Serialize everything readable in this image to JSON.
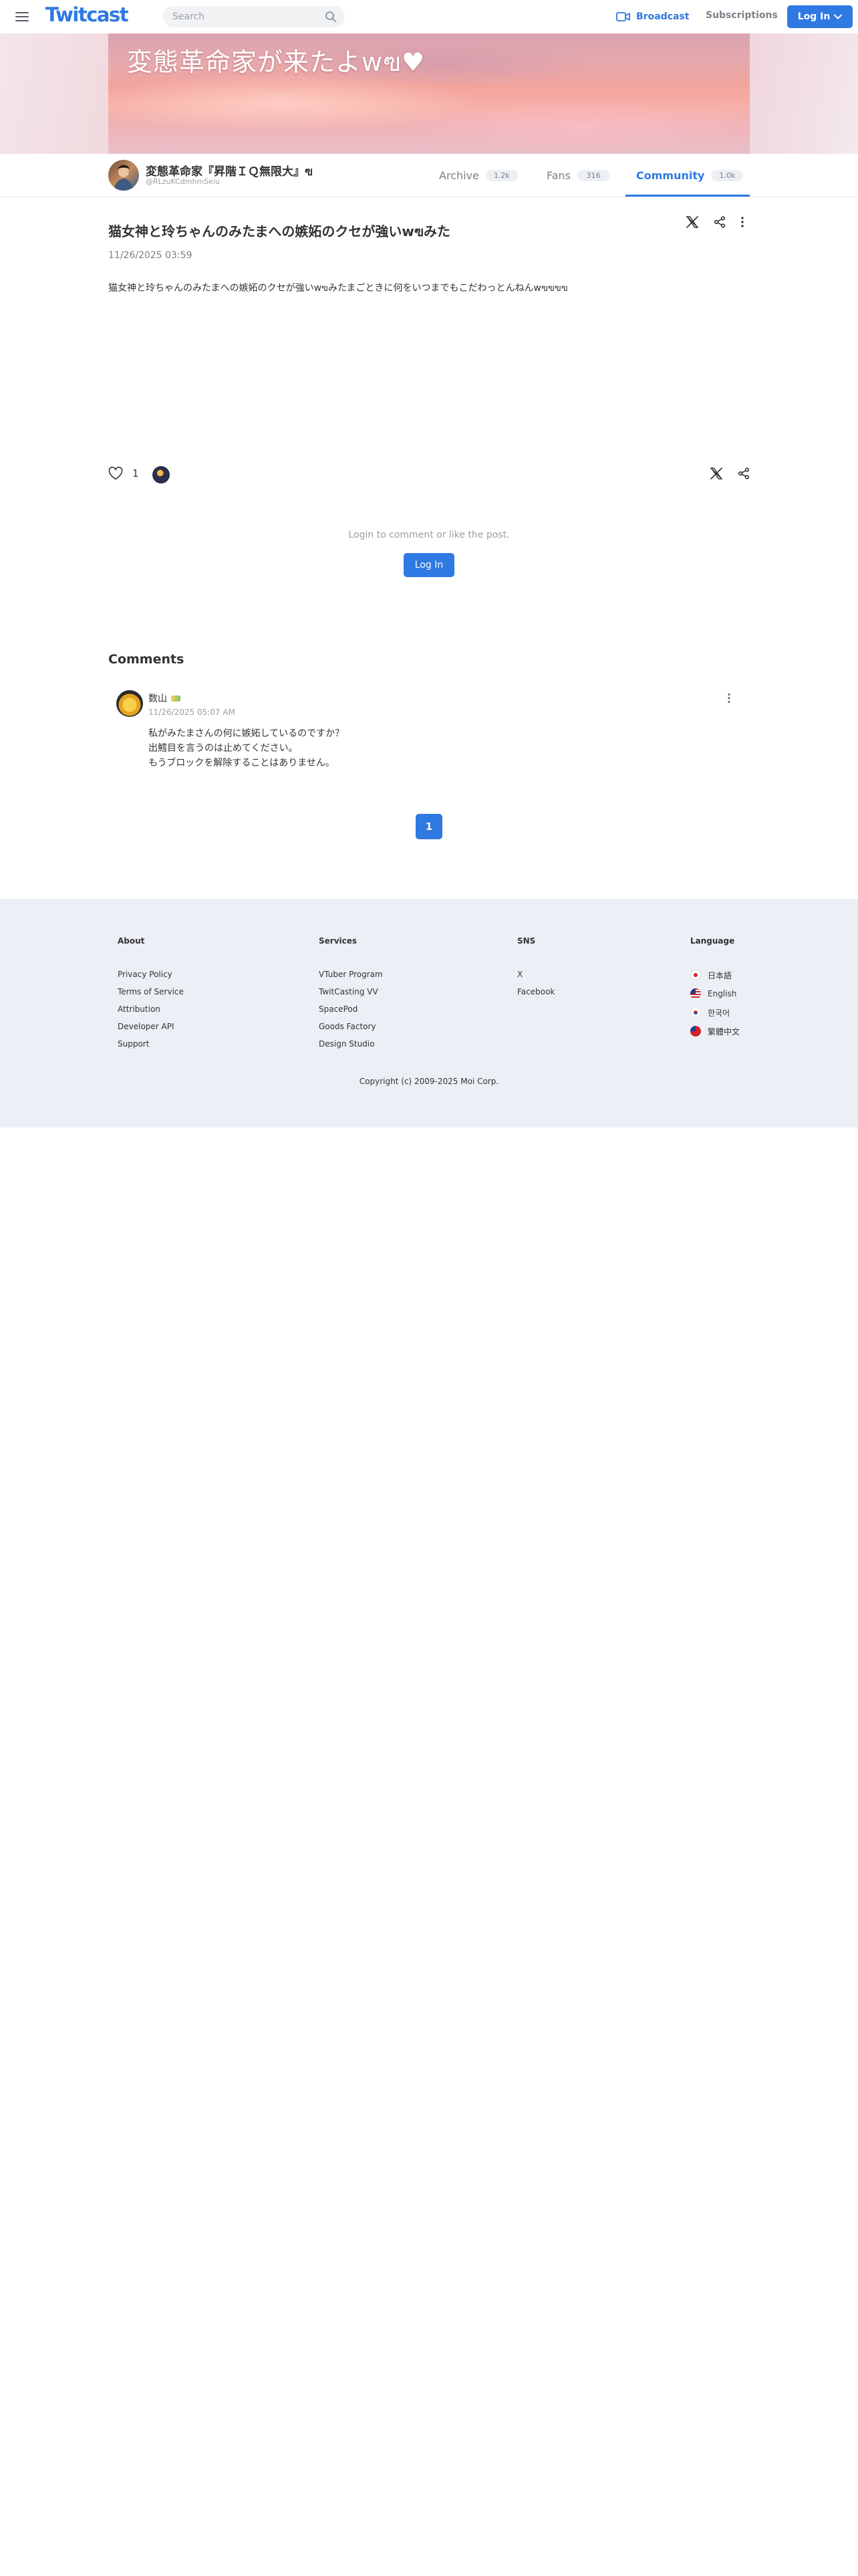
{
  "header": {
    "logo": "Twitcast",
    "search_placeholder": "Search",
    "broadcast_label": "Broadcast",
    "subscriptions_label": "Subscriptions",
    "login_label": "Log In",
    "accent_color": "#2f79e3"
  },
  "banner": {
    "title": "変態革命家が来たよwฃ♥"
  },
  "profile": {
    "name": "変態革命家『昇階ＩＱ無限大』ฃ",
    "handle": "@RLzuKCdmhmSeiu",
    "tabs": [
      {
        "label": "Archive",
        "count": "1.2k"
      },
      {
        "label": "Fans",
        "count": "316"
      },
      {
        "label": "Community",
        "count": "1.0k"
      }
    ],
    "active_tab": "Community"
  },
  "post": {
    "title": "猫女神と玲ちゃんのみたまへの嫉妬のクセが強いwฃみた",
    "date": "11/26/2025 03:59",
    "body": "猫女神と玲ちゃんのみたまへの嫉妬のクセが強いwฃみたまごときに何をいつまでもこだわっとんねんwฃฃฃฃ",
    "like_count": "1",
    "login_prompt": "Login to comment or like the post.",
    "login_button": "Log In"
  },
  "comments": {
    "heading": "Comments",
    "items": [
      {
        "author": "数山",
        "date": "11/26/2025 05:07 AM",
        "lines": [
          "私がみたまさんの何に嫉妬しているのですか？",
          "出鱈目を言うのは止めてください。",
          "もうブロックを解除することはありません。"
        ]
      }
    ]
  },
  "pagination": {
    "current_page": "1"
  },
  "footer": {
    "columns": [
      {
        "heading": "About",
        "links": [
          "Privacy Policy",
          "Terms of Service",
          "Attribution",
          "Developer API",
          "Support"
        ]
      },
      {
        "heading": "Services",
        "links": [
          "VTuber Program",
          "TwitCasting VV",
          "SpacePod",
          "Goods Factory",
          "Design Studio"
        ]
      },
      {
        "heading": "SNS",
        "links": [
          "X",
          "Facebook"
        ]
      }
    ],
    "language": {
      "heading": "Language",
      "items": [
        "日本語",
        "English",
        "한국어",
        "繁體中文"
      ]
    },
    "copyright": "Copyright (c) 2009-2025 Moi Corp."
  }
}
